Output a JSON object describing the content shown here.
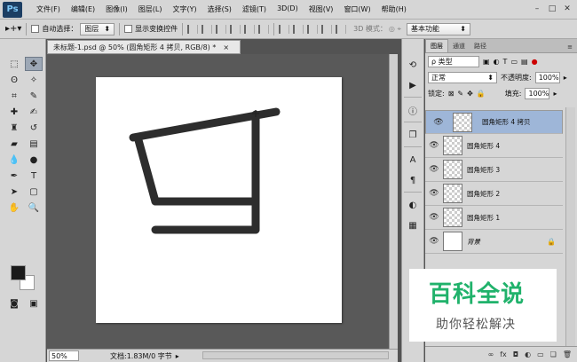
{
  "app": {
    "logo": "Ps"
  },
  "menu": [
    "文件(F)",
    "编辑(E)",
    "图像(I)",
    "图层(L)",
    "文字(Y)",
    "选择(S)",
    "滤镜(T)",
    "3D(D)",
    "视图(V)",
    "窗口(W)",
    "帮助(H)"
  ],
  "options": {
    "auto_select_label": "自动选择：",
    "auto_select_value": "图层",
    "show_transform_label": "显示变换控件",
    "mode_3d_label": "3D 模式：",
    "workspace": "基本功能"
  },
  "document": {
    "tab_title": "未标题-1.psd @ 50% (圆角矩形 4 拷贝, RGB/8) *",
    "zoom": "50%",
    "doc_info": "文档:1.83M/0 字节"
  },
  "panel": {
    "tabs": [
      "图层",
      "通道",
      "路径"
    ],
    "filter_kind": "类型",
    "blend_mode": "正常",
    "opacity_label": "不透明度:",
    "opacity": "100%",
    "lock_label": "锁定:",
    "fill_label": "填充:",
    "fill": "100%"
  },
  "layers": [
    {
      "name": "圆角矩形 4 拷贝",
      "selected": true
    },
    {
      "name": "圆角矩形 4",
      "selected": false
    },
    {
      "name": "圆角矩形 3",
      "selected": false
    },
    {
      "name": "圆角矩形 2",
      "selected": false
    },
    {
      "name": "圆角矩形 1",
      "selected": false
    },
    {
      "name": "背景",
      "selected": false,
      "locked": true
    }
  ],
  "watermark": {
    "title": "百科全说",
    "subtitle": "助你轻松解决"
  },
  "colors": {
    "foreground": "#1b1b1b",
    "background": "#ffffff",
    "accent": "#20b26b",
    "selection": "#9eb6d8"
  }
}
